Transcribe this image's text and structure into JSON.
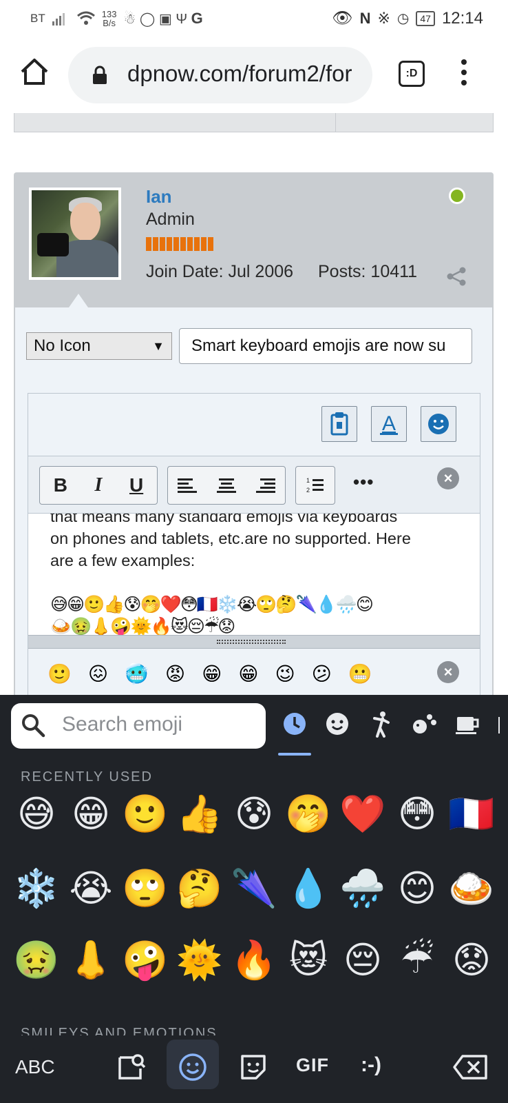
{
  "status_bar": {
    "carrier": "BT",
    "net_speed_value": "133",
    "net_speed_unit": "B/s",
    "battery": "47",
    "time": "12:14"
  },
  "browser": {
    "url": "dpnow.com/forum2/for",
    "tabs_label": ":D"
  },
  "post": {
    "username": "Ian",
    "role": "Admin",
    "join_date": "Join Date: Jul 2006",
    "posts": "Posts: 10411",
    "reputation_bars": 10,
    "online": true
  },
  "editor": {
    "icon_select": "No Icon",
    "title_value": "Smart keyboard emojis are now su",
    "toolbar": {
      "bold": "B",
      "italic": "I",
      "underline": "U",
      "more": "•••"
    },
    "body_lines": [
      "that means many standard emojis via keyboards",
      "on phones and tablets, etc.are no supported. Here",
      "are a few examples:"
    ],
    "body_emojis_1": "😅😁🙂👍😰🤭❤️😳🇫🇷❄️😭🙄🤔🌂💧🌧️😊",
    "body_emojis_2": "🍛🤢👃🤪🌞🔥😻😔☔😟",
    "smiley_strip": "🙂😖🥶😡😁😁😉😕😬"
  },
  "keyboard": {
    "search_placeholder": "Search emoji",
    "recent_label": "RECENTLY USED",
    "smileys_label": "SMILEYS AND EMOTIONS",
    "abc_label": "ABC",
    "gif_label": "GIF",
    "emoticon_label": ":-)",
    "recent_row_1": [
      "😅",
      "😁",
      "🙂",
      "👍",
      "😰",
      "🤭",
      "❤️",
      "😳",
      "🇫🇷"
    ],
    "recent_row_2": [
      "❄️",
      "😭",
      "🙄",
      "🤔",
      "🌂",
      "💧",
      "🌧️",
      "😊",
      "🍛"
    ],
    "recent_row_3": [
      "🤢",
      "👃",
      "🤪",
      "🌞",
      "🔥",
      "😻",
      "😔",
      "☔",
      "😟"
    ]
  },
  "colors": {
    "accent_blue": "#2d7bbf",
    "online_green": "#84b521",
    "rep_orange": "#e8720c",
    "keyboard_bg": "#202328",
    "keyboard_accent": "#8ab4f8"
  }
}
